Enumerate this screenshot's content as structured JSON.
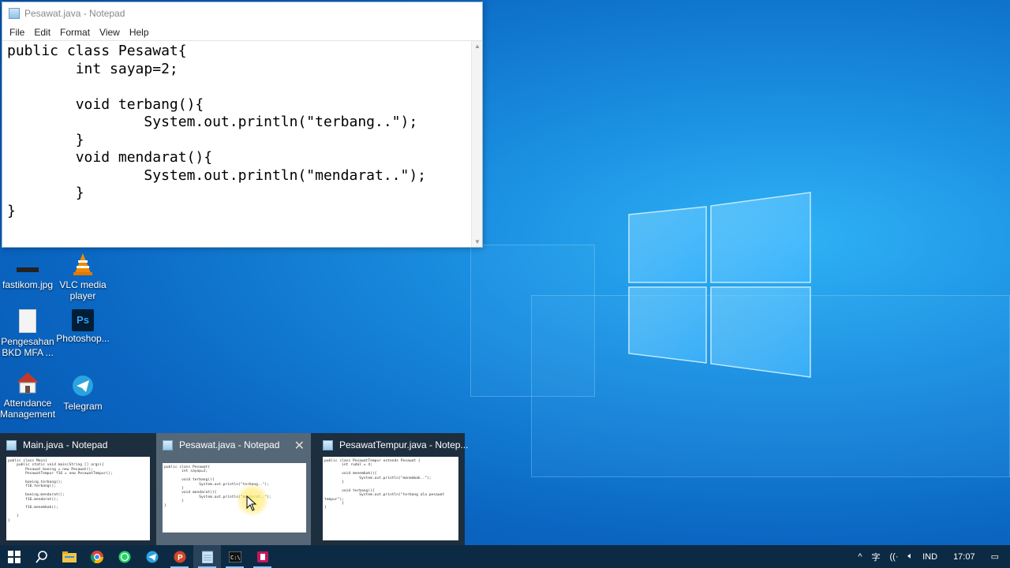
{
  "notepad": {
    "title": "Pesawat.java - Notepad",
    "menu": [
      "File",
      "Edit",
      "Format",
      "View",
      "Help"
    ],
    "code": "public class Pesawat{\n        int sayap=2;\n\n        void terbang(){\n                System.out.println(\"terbang..\");\n        }\n        void mendarat(){\n                System.out.println(\"mendarat..\");\n        }\n}"
  },
  "desktop_icons": [
    {
      "label": "fastikom.jpg",
      "icon": "image-file-icon"
    },
    {
      "label": "VLC media player",
      "icon": "vlc-cone-icon"
    },
    {
      "label": "Pengesahan BKD MFA ...",
      "icon": "document-file-icon"
    },
    {
      "label": "Photoshop...",
      "icon": "photoshop-icon"
    },
    {
      "label": "Attendance Management",
      "icon": "attendance-house-icon"
    },
    {
      "label": "Telegram",
      "icon": "telegram-icon"
    }
  ],
  "thumbnails": [
    {
      "title": "Main.java - Notepad",
      "preview": "public class Main{\n    public static void main(String [] args){\n        Pesawat boeing = new Pesawat();\n        PesawatTempur f16 = new PesawatTempur();\n\n        boeing.terbang();\n        f16.terbang();\n\n        boeing.mendarat();\n        f16.mendarat();\n\n        f16.menembak();\n\n    }\n}"
    },
    {
      "title": "Pesawat.java - Notepad",
      "preview": "public class Pesawat{\n        int sayap=2;\n\n        void terbang(){\n                System.out.println(\"terbang..\");\n        }\n        void mendarat(){\n                System.out.println(\"mendarat..\");\n        }\n}"
    },
    {
      "title": "PesawatTempur.java - Notep...",
      "preview": "public class PesawatTempur extends Pesawat {\n        int rudal = 4;\n\n        void menembak(){\n                System.out.println(\"menembak..\");\n        }\n\n        void terbang(){\n                System.out.println(\"terbang ala pesawat\ntempur\");\n        }\n}"
    }
  ],
  "taskbar": {
    "apps": [
      "start-icon",
      "search-icon",
      "file-explorer-icon",
      "chrome-icon",
      "whatsapp-icon",
      "telegram-icon",
      "powerpoint-icon",
      "notepad-icon",
      "cmd-icon",
      "app-icon"
    ],
    "tray": {
      "language": "IND",
      "time": "17:07"
    }
  }
}
